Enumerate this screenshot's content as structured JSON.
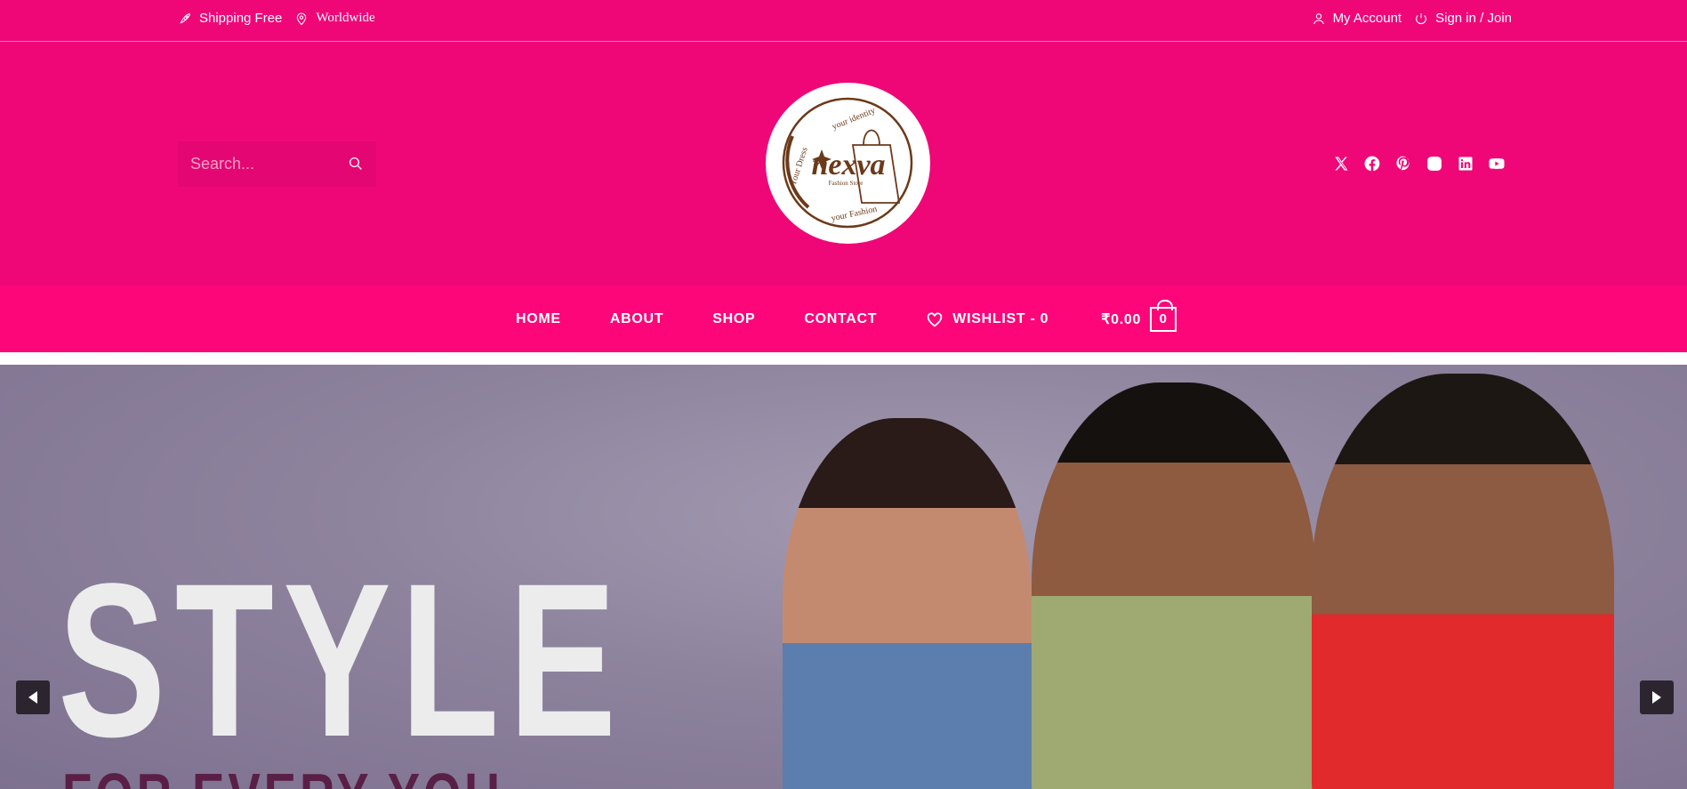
{
  "topbar": {
    "shipping": "Shipping Free",
    "location": "Worldwide",
    "account": "My Account",
    "signin": "Sign in / Join"
  },
  "search": {
    "placeholder": "Search..."
  },
  "logo": {
    "brand": "nexva",
    "tagline": "Fashion Store",
    "arc_top": "your identity",
    "arc_left": "Your Dress",
    "arc_bottom": "your Fashion"
  },
  "social": [
    "x-icon",
    "facebook-icon",
    "pinterest-icon",
    "instagram-icon",
    "linkedin-icon",
    "youtube-icon"
  ],
  "nav": {
    "items": [
      {
        "label": "HOME"
      },
      {
        "label": "ABOUT"
      },
      {
        "label": "SHOP"
      },
      {
        "label": "CONTACT"
      }
    ],
    "wishlist": "WISHLIST - 0",
    "cart_total": "₹0.00",
    "cart_count": "0"
  },
  "hero": {
    "title": "STYLE",
    "subtitle": "FOR EVERY YOU"
  },
  "colors": {
    "brand_pink": "#ef0778",
    "nav_pink": "#fc067a",
    "logo_brown": "#6b3a1a"
  }
}
